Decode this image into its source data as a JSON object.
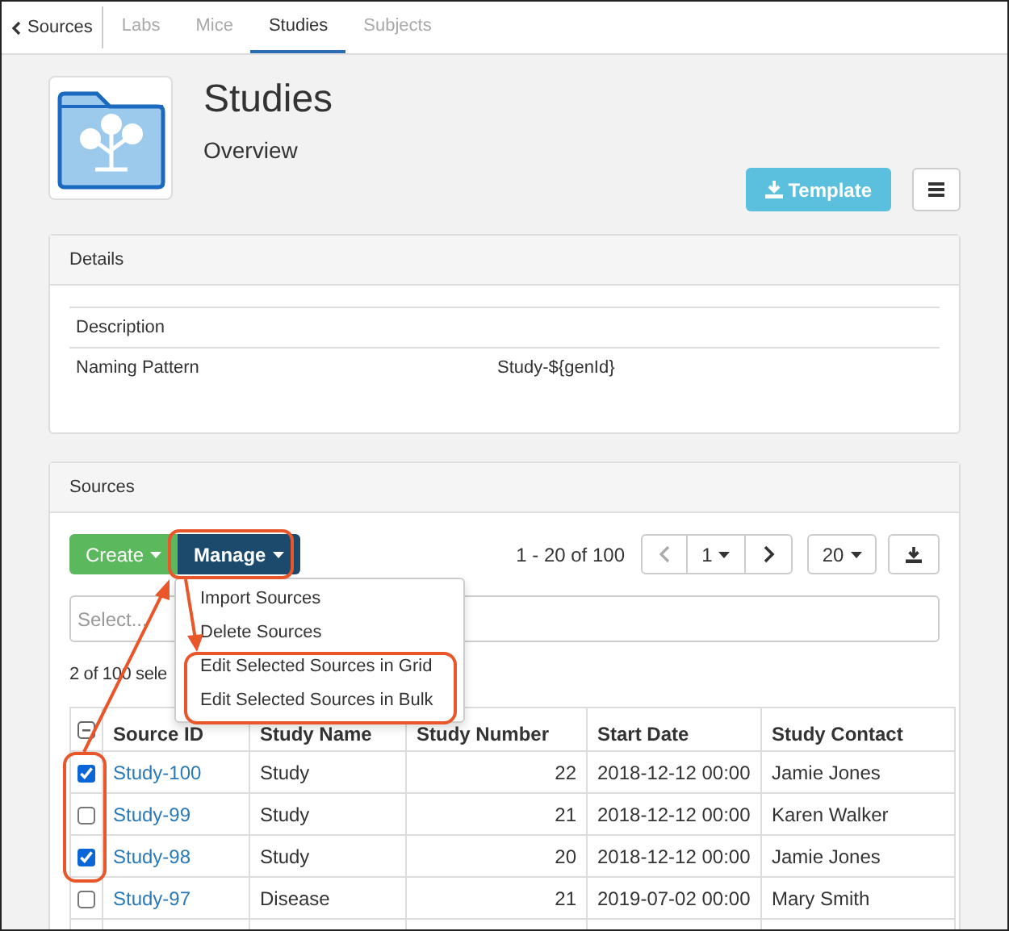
{
  "nav": {
    "back": "Sources",
    "tabs": [
      {
        "label": "Labs",
        "selected": false
      },
      {
        "label": "Mice",
        "selected": false
      },
      {
        "label": "Studies",
        "selected": true
      },
      {
        "label": "Subjects",
        "selected": false
      }
    ]
  },
  "header": {
    "title": "Studies",
    "subtitle": "Overview",
    "template_button": "Template"
  },
  "details": {
    "title": "Details",
    "rows": [
      {
        "label": "Description"
      },
      {
        "label": "Naming Pattern",
        "value": "Study-${genId}"
      }
    ]
  },
  "sources": {
    "title": "Sources",
    "create_button": "Create",
    "manage_button": "Manage",
    "paging": "1 - 20 of 100",
    "page": "1",
    "page_size": "20",
    "filter_placeholder": "Select...",
    "selection_text": "2 of 100 sele",
    "menu": [
      "Import Sources",
      "Delete Sources",
      "Edit Selected Sources in Grid",
      "Edit Selected Sources in Bulk"
    ],
    "columns": [
      "Source ID",
      "Study Name",
      "Study Number",
      "Start Date",
      "Study Contact"
    ],
    "rows": [
      {
        "selected": true,
        "cells": [
          "Study-100",
          "Study",
          "22",
          "2018-12-12 00:00",
          "Jamie Jones"
        ]
      },
      {
        "selected": false,
        "cells": [
          "Study-99",
          "Study",
          "21",
          "2018-12-12 00:00",
          "Karen Walker"
        ]
      },
      {
        "selected": true,
        "cells": [
          "Study-98",
          "Study",
          "20",
          "2018-12-12 00:00",
          "Jamie Jones"
        ]
      },
      {
        "selected": false,
        "cells": [
          "Study-97",
          "Disease",
          "21",
          "2019-07-02 00:00",
          "Mary Smith"
        ]
      }
    ]
  }
}
